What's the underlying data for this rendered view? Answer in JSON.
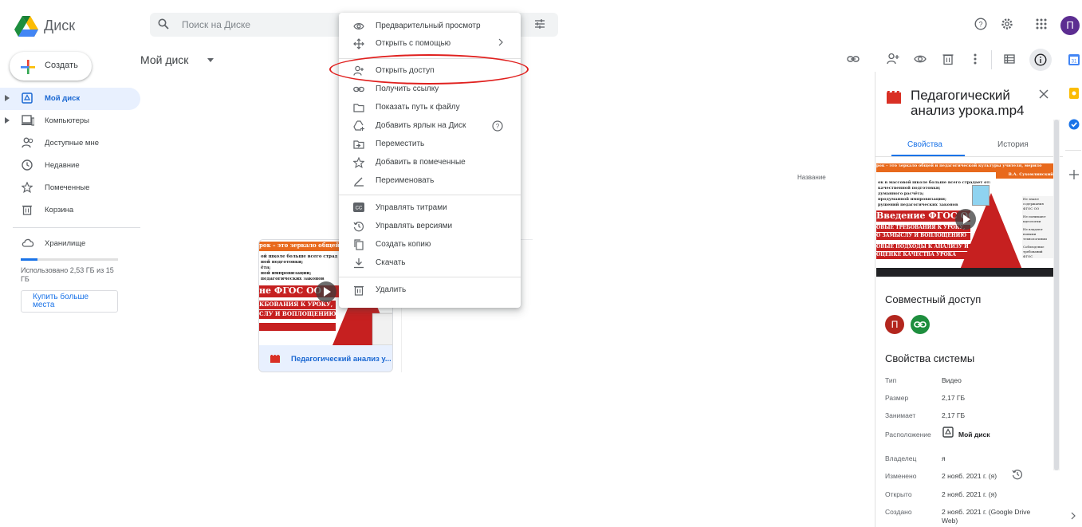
{
  "app": {
    "title": "Диск",
    "search_placeholder": "Поиск на Диске",
    "avatar_letter": "П"
  },
  "sidebar": {
    "create_label": "Создать",
    "items": [
      {
        "label": "Мой диск",
        "icon": "my-drive-icon",
        "active": true
      },
      {
        "label": "Компьютеры",
        "icon": "computer-icon"
      },
      {
        "label": "Доступные мне",
        "icon": "shared-icon"
      },
      {
        "label": "Недавние",
        "icon": "clock-icon"
      },
      {
        "label": "Помеченные",
        "icon": "star-icon"
      },
      {
        "label": "Корзина",
        "icon": "trash-icon"
      }
    ],
    "storage_label": "Хранилище",
    "storage_used_text": "Использовано 2,53 ГБ из 15 ГБ",
    "storage_fraction": 0.17,
    "buy_more_label": "Купить больше места"
  },
  "main": {
    "breadcrumb": "Мой диск",
    "sort_label": "Название",
    "file": {
      "name": "Педагогический анализ урока.mp4",
      "name_display": "Педагогический анализ у..."
    }
  },
  "context_menu": {
    "items": [
      {
        "label": "Предварительный просмотр",
        "icon": "eye-icon"
      },
      {
        "label": "Открыть с помощью",
        "icon": "open-with-icon",
        "submenu": true
      },
      {
        "label": "Открыть доступ",
        "icon": "share-person-icon",
        "highlighted": true
      },
      {
        "label": "Получить ссылку",
        "icon": "link-icon"
      },
      {
        "label": "Показать путь к файлу",
        "icon": "folder-icon"
      },
      {
        "label": "Добавить ярлык на Диск",
        "icon": "add-shortcut-icon",
        "help": true
      },
      {
        "label": "Переместить",
        "icon": "move-icon"
      },
      {
        "label": "Добавить в помеченные",
        "icon": "star-icon"
      },
      {
        "label": "Переименовать",
        "icon": "pencil-icon"
      },
      {
        "label": "Управлять титрами",
        "icon": "captions-icon"
      },
      {
        "label": "Управлять версиями",
        "icon": "history-icon"
      },
      {
        "label": "Создать копию",
        "icon": "copy-icon"
      },
      {
        "label": "Скачать",
        "icon": "download-icon"
      },
      {
        "label": "Удалить",
        "icon": "trash-icon"
      }
    ]
  },
  "details": {
    "title": "Педагогический анализ урока.mp4",
    "tabs": [
      "Свойства",
      "История"
    ],
    "sharing_title": "Совместный доступ",
    "system_title": "Свойства системы",
    "properties": [
      {
        "k": "Тип",
        "v": "Видео"
      },
      {
        "k": "Размер",
        "v": "2,17 ГБ"
      },
      {
        "k": "Занимает",
        "v": "2,17 ГБ"
      },
      {
        "k": "Расположение",
        "v": "Мой диск"
      },
      {
        "k": "Владелец",
        "v": "я"
      },
      {
        "k": "Изменено",
        "v": "2 нояб. 2021 г. (я)"
      },
      {
        "k": "Открыто",
        "v": "2 нояб. 2021 г. (я)"
      },
      {
        "k": "Создано",
        "v": "2 нояб. 2021 г. (Google Drive Web)"
      }
    ]
  },
  "slide": {
    "line1": "рок – это зеркало общей и педагогической культуры учителя, мерило",
    "quote_author": "В.А. Сухомлинский",
    "line_a": "ок в массовой школе больше всего страдает от:",
    "line_b": "качественной подготовки;",
    "line_c": "думанного расчёта;",
    "line_d": "продуманной импровизации;",
    "line_e": "рушений педагогических законов",
    "heading1": "Введение ФГОС ОО",
    "heading2": "ОВЫЕ ТРЕБОВАНИЯ К УРОКУ,",
    "heading3": "О ЗАМЫСЛУ И ВОПЛОЩЕНИЮ",
    "heading4": "ОВЫЕ ПОДХОДЫ К АНАЛИЗУ И",
    "heading5": "ОЦЕНКЕ КАЧЕСТВА УРОКА",
    "card_l1": "ой школе больше всего страд",
    "card_l2": "ной подготовки;",
    "card_l3": "ёта;",
    "card_l4": "ной импровизации;",
    "card_l5": "педагогических законов",
    "card_h1": "не ФГОС ОО",
    "card_h2": "КБОВАНИЯ К УРОКУ,",
    "card_h3": "СЛУ И ВОПЛОЩЕНИЮ",
    "side1": "Не знают содержания ФГОС ОО",
    "side2": "Не понимают идеологии",
    "side3": "Не владеют новыми технологиями",
    "side4": "Соблюдение требований ФГОС"
  },
  "colors": {
    "accent": "#1a73e8",
    "annotation": "#e0201e",
    "avatar": "#5c2d91",
    "share_owner": "#b3261e",
    "share_link": "#1e8e3e"
  }
}
